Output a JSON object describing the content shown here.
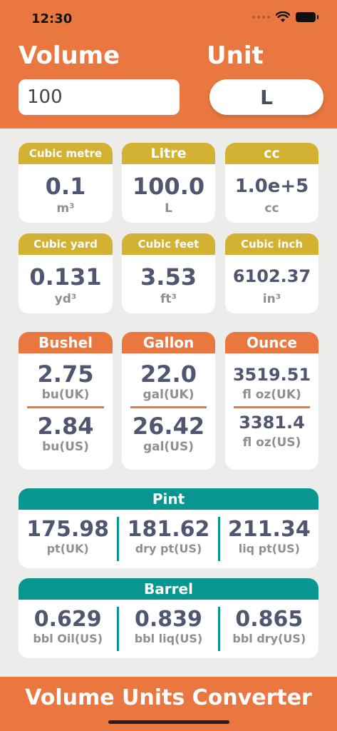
{
  "status": {
    "time": "12:30"
  },
  "header": {
    "volume_label": "Volume",
    "unit_label": "Unit",
    "volume_value": "100",
    "unit_value": "L"
  },
  "simple_cards": [
    {
      "title": "Cubic metre",
      "value": "0.1",
      "unit": "m³"
    },
    {
      "title": "Litre",
      "value": "100.0",
      "unit": "L"
    },
    {
      "title": "cc",
      "value": "1.0e+5",
      "unit": "cc"
    },
    {
      "title": "Cubic yard",
      "value": "0.131",
      "unit": "yd³"
    },
    {
      "title": "Cubic feet",
      "value": "3.53",
      "unit": "ft³"
    },
    {
      "title": "Cubic inch",
      "value": "6102.37",
      "unit": "in³"
    }
  ],
  "dual_cards": [
    {
      "title": "Bushel",
      "v1": "2.75",
      "u1": "bu(UK)",
      "v2": "2.84",
      "u2": "bu(US)"
    },
    {
      "title": "Gallon",
      "v1": "22.0",
      "u1": "gal(UK)",
      "v2": "26.42",
      "u2": "gal(US)"
    },
    {
      "title": "Ounce",
      "v1": "3519.51",
      "u1": "fl oz(UK)",
      "v2": "3381.4",
      "u2": "fl oz(US)"
    }
  ],
  "wide_cards": [
    {
      "title": "Pint",
      "items": [
        {
          "value": "175.98",
          "unit": "pt(UK)"
        },
        {
          "value": "181.62",
          "unit": "dry pt(US)"
        },
        {
          "value": "211.34",
          "unit": "liq pt(US)"
        }
      ]
    },
    {
      "title": "Barrel",
      "items": [
        {
          "value": "0.629",
          "unit": "bbl Oil(US)"
        },
        {
          "value": "0.839",
          "unit": "bbl liq(US)"
        },
        {
          "value": "0.865",
          "unit": "bbl dry(US)"
        }
      ]
    }
  ],
  "footer": {
    "title": "Volume Units Converter"
  },
  "colors": {
    "orange": "#e9773f",
    "gold": "#d3b132",
    "teal": "#0a9690",
    "value_text": "#4f5670"
  }
}
